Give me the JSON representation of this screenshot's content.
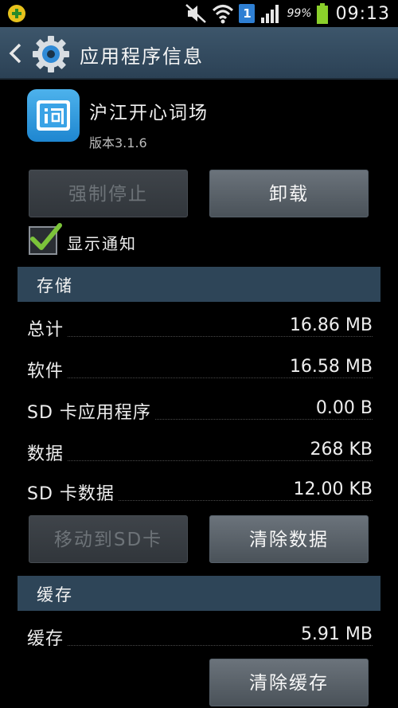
{
  "status_bar": {
    "battery_percent": "99%",
    "time": "09:13",
    "sim_label": "1"
  },
  "action_bar": {
    "title": "应用程序信息"
  },
  "app": {
    "name": "沪江开心词场",
    "version": "版本3.1.6"
  },
  "buttons": {
    "force_stop": "强制停止",
    "uninstall": "卸载",
    "move_to_sd": "移动到SD卡",
    "clear_data": "清除数据",
    "clear_cache": "清除缓存"
  },
  "notification": {
    "label": "显示通知",
    "checked": true
  },
  "storage": {
    "header": "存储",
    "rows": [
      {
        "label": "总计",
        "value": "16.86 MB"
      },
      {
        "label": "软件",
        "value": "16.58 MB"
      },
      {
        "label": "SD 卡应用程序",
        "value": "0.00 B"
      },
      {
        "label": "数据",
        "value": "268 KB"
      },
      {
        "label": "SD 卡数据",
        "value": "12.00 KB"
      }
    ]
  },
  "cache": {
    "header": "缓存",
    "rows": [
      {
        "label": "缓存",
        "value": "5.91 MB"
      }
    ]
  },
  "colors": {
    "accent_check": "#7cc43a",
    "action_bar": "#34495c",
    "section_header": "#2e4558"
  }
}
